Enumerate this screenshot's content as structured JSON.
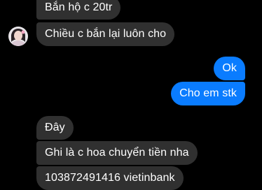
{
  "conversation": {
    "messages": [
      {
        "side": "in",
        "text": "Bắn hộ c 20tr"
      },
      {
        "side": "in",
        "text": "Chiều c bắn lại luôn cho"
      },
      {
        "side": "out",
        "text": "Ok"
      },
      {
        "side": "out",
        "text": "Cho em stk"
      },
      {
        "side": "in",
        "text": "Đây"
      },
      {
        "side": "in",
        "text": "Ghi là c hoa chuyển tiền nha"
      },
      {
        "side": "in",
        "text": "103872491416 vietinbank"
      }
    ]
  },
  "colors": {
    "background": "#000000",
    "incoming_bubble": "#303030",
    "outgoing_bubble": "#0a7cff",
    "text": "#ffffff"
  },
  "icons": {
    "avatar": "contact-avatar"
  }
}
